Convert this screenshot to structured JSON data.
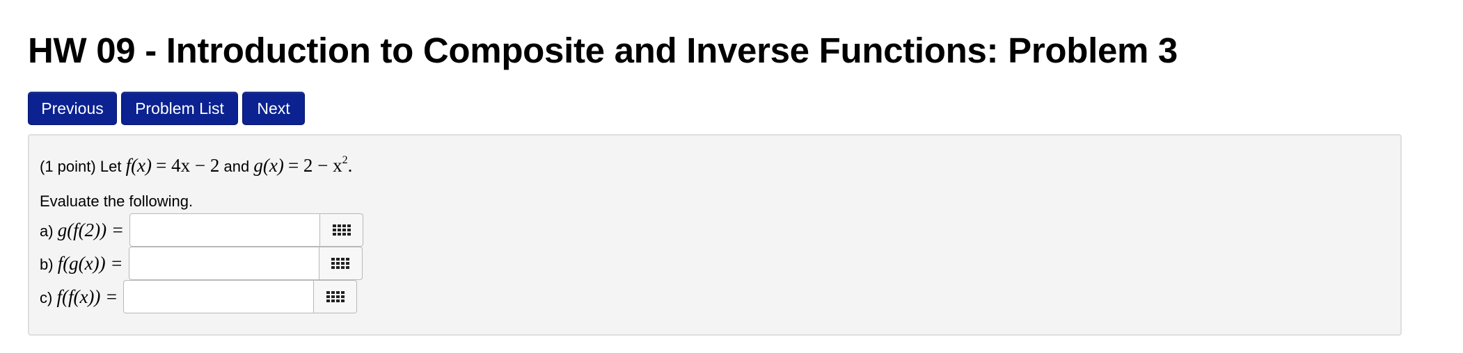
{
  "page": {
    "title": "HW 09 - Introduction to Composite and Inverse Functions: Problem 3"
  },
  "nav": {
    "previous_label": "Previous",
    "problem_list_label": "Problem List",
    "next_label": "Next"
  },
  "colors": {
    "button_bg": "#0b2290",
    "button_text": "#ffffff",
    "problem_bg": "#f4f4f4",
    "problem_border": "#dedede"
  },
  "problem": {
    "points": "(1 point)",
    "let_text": "Let",
    "and_text": "and",
    "f_def_lhs": "f(x)",
    "f_def_rhs": "= 4x − 2",
    "g_def_lhs": "g(x)",
    "g_def_rhs_base": "= 2 − x",
    "g_def_rhs_exp": "2",
    "period": ".",
    "instruction": "Evaluate the following.",
    "parts": [
      {
        "label": "a)",
        "expr": "g(f(2)) =",
        "value": "",
        "placeholder": "",
        "keypad_icon": "keypad-icon"
      },
      {
        "label": "b)",
        "expr": "f(g(x)) =",
        "value": "",
        "placeholder": "",
        "keypad_icon": "keypad-icon"
      },
      {
        "label": "c)",
        "expr": "f(f(x)) =",
        "value": "",
        "placeholder": "",
        "keypad_icon": "keypad-icon"
      }
    ]
  }
}
